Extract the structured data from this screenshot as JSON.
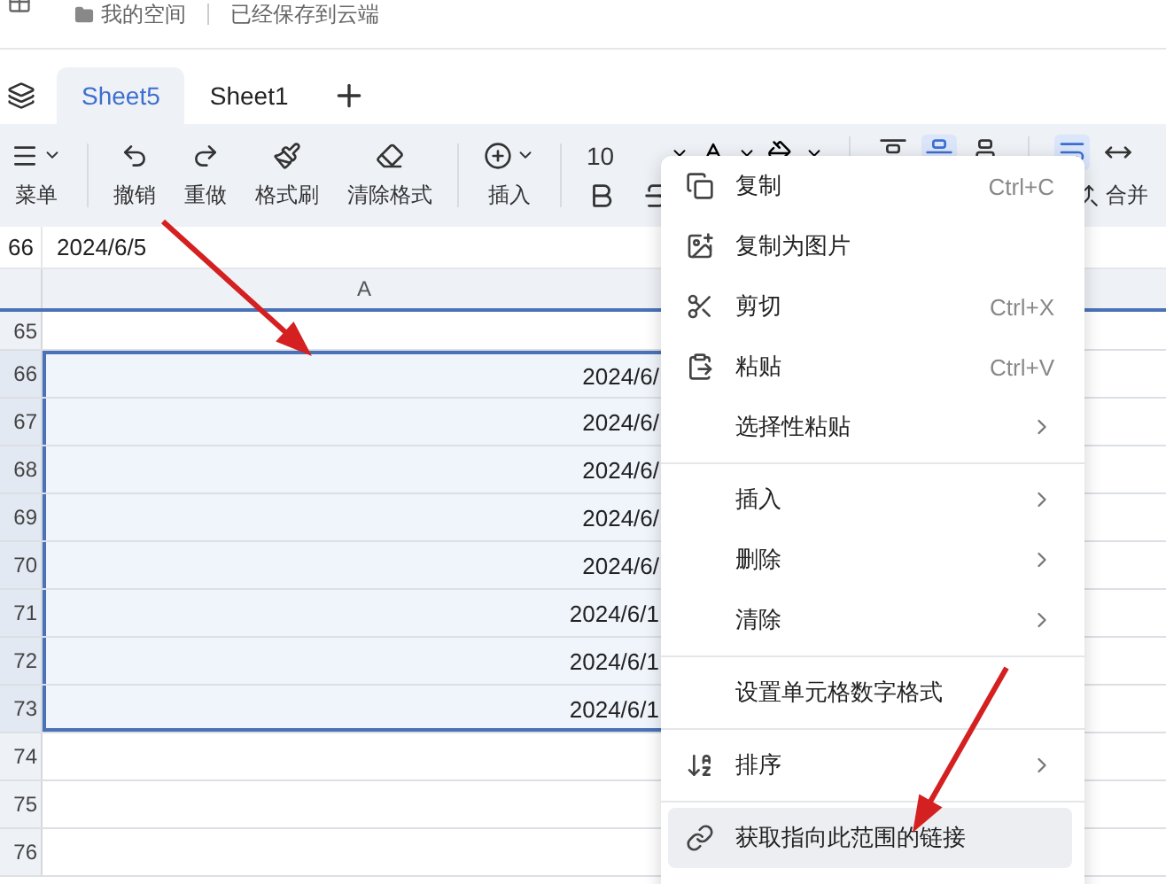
{
  "header": {
    "breadcrumb": "我的空间",
    "save_status": "已经保存到云端"
  },
  "sheet_tabs": [
    {
      "label": "Sheet5",
      "selected": true
    },
    {
      "label": "Sheet1",
      "selected": false
    }
  ],
  "toolbar": {
    "items": [
      {
        "kind": "menu",
        "label": "菜单"
      },
      {
        "kind": "divider"
      },
      {
        "kind": "undo",
        "label": "撤销"
      },
      {
        "kind": "redo",
        "label": "重做"
      },
      {
        "kind": "brush",
        "label": "格式刷"
      },
      {
        "kind": "eraser",
        "label": "清除格式"
      },
      {
        "kind": "divider"
      },
      {
        "kind": "insert",
        "label": "插入"
      },
      {
        "kind": "divider"
      }
    ],
    "font_size": "10",
    "merge_label": "合并"
  },
  "formula_bar": {
    "cell_ref": "66",
    "value": "2024/6/5"
  },
  "grid": {
    "column_header": "A",
    "rows": [
      {
        "number": "65",
        "value": "",
        "selected": false
      },
      {
        "number": "66",
        "value": "2024/6/",
        "selected": true
      },
      {
        "number": "67",
        "value": "2024/6/",
        "selected": true
      },
      {
        "number": "68",
        "value": "2024/6/",
        "selected": true
      },
      {
        "number": "69",
        "value": "2024/6/",
        "selected": true
      },
      {
        "number": "70",
        "value": "2024/6/",
        "selected": true
      },
      {
        "number": "71",
        "value": "2024/6/1",
        "selected": true
      },
      {
        "number": "72",
        "value": "2024/6/1",
        "selected": true
      },
      {
        "number": "73",
        "value": "2024/6/1",
        "selected": true
      },
      {
        "number": "74",
        "value": "",
        "selected": false
      },
      {
        "number": "75",
        "value": "",
        "selected": false
      },
      {
        "number": "76",
        "value": "",
        "selected": false
      }
    ]
  },
  "context_menu": {
    "items": [
      {
        "kind": "copy",
        "label": "复制",
        "shortcut": "Ctrl+C",
        "submenu": false,
        "highlighted": false
      },
      {
        "kind": "image",
        "label": "复制为图片",
        "submenu": false,
        "highlighted": false
      },
      {
        "kind": "cut",
        "label": "剪切",
        "shortcut": "Ctrl+X",
        "submenu": false,
        "highlighted": false
      },
      {
        "kind": "paste",
        "label": "粘贴",
        "shortcut": "Ctrl+V",
        "submenu": false,
        "highlighted": false
      },
      {
        "kind": "plain",
        "label": "选择性粘贴",
        "submenu": true,
        "highlighted": false
      },
      {
        "kind": "divider"
      },
      {
        "kind": "plain",
        "label": "插入",
        "submenu": true,
        "highlighted": false
      },
      {
        "kind": "plain",
        "label": "删除",
        "submenu": true,
        "highlighted": false
      },
      {
        "kind": "plain",
        "label": "清除",
        "submenu": true,
        "highlighted": false
      },
      {
        "kind": "divider"
      },
      {
        "kind": "plain",
        "label": "设置单元格数字格式",
        "submenu": false,
        "highlighted": false
      },
      {
        "kind": "divider"
      },
      {
        "kind": "sort",
        "label": "排序",
        "submenu": true,
        "highlighted": false
      },
      {
        "kind": "divider"
      },
      {
        "kind": "link",
        "label": "获取指向此范围的链接",
        "submenu": false,
        "highlighted": true
      }
    ]
  }
}
